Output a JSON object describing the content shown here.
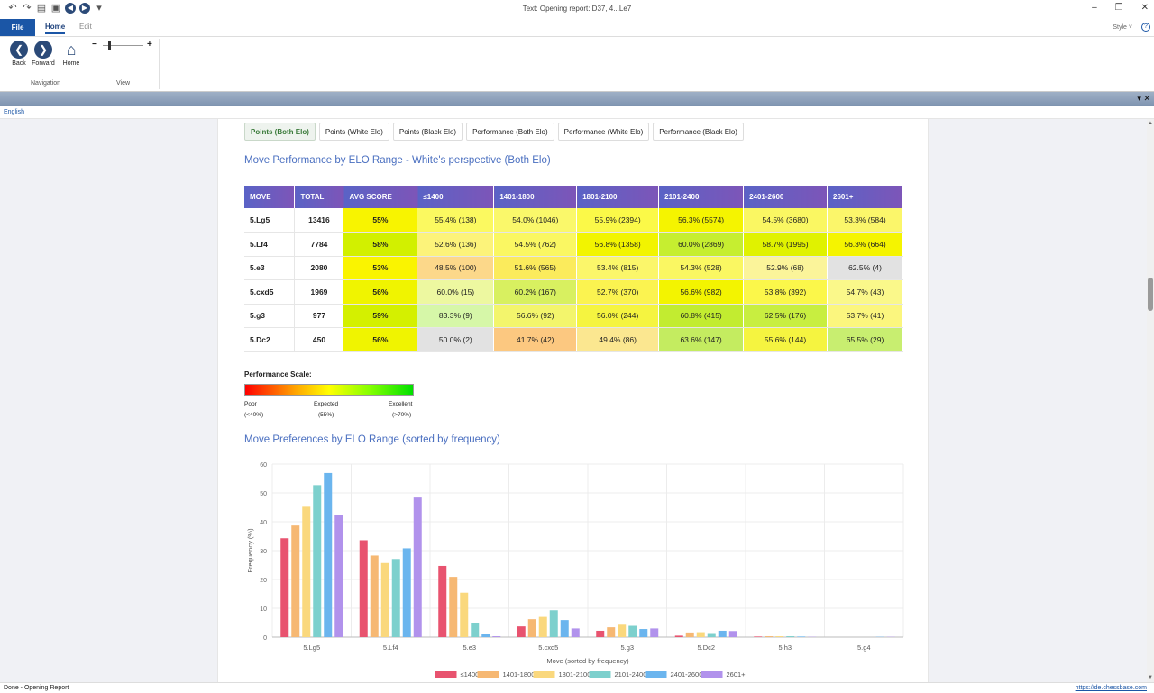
{
  "window": {
    "title": "Text: Opening report: D37,   4...Le7"
  },
  "ribbon": {
    "tabs": {
      "file": "File",
      "home": "Home",
      "edit": "Edit"
    },
    "style_label": "Style",
    "buttons": {
      "back": "Back",
      "forward": "Forward",
      "home": "Home"
    },
    "groups": {
      "navigation": "Navigation",
      "view": "View"
    }
  },
  "doc_tab": "English",
  "subtabs": [
    "Points (Both Elo)",
    "Points (White Elo)",
    "Points (Black Elo)",
    "Performance (Both Elo)",
    "Performance (White Elo)",
    "Performance (Black Elo)"
  ],
  "perf": {
    "title": "Move Performance by ELO Range - White's perspective (Both Elo)",
    "headers": [
      "MOVE",
      "TOTAL",
      "AVG SCORE",
      "≤1400",
      "1401-1800",
      "1801-2100",
      "2101-2400",
      "2401-2600",
      "2601+"
    ],
    "rows": [
      {
        "move": "5.Lg5",
        "total": "13416",
        "avg": "55%",
        "avg_bg": "#f8f400",
        "cells": [
          [
            "55.4% (138)",
            "#fbf960"
          ],
          [
            "54.0% (1046)",
            "#faf86a"
          ],
          [
            "55.9% (2394)",
            "#fbf948"
          ],
          [
            "56.3% (5574)",
            "#f5f400"
          ],
          [
            "54.5% (3680)",
            "#faf762"
          ],
          [
            "53.3% (584)",
            "#fbf66a"
          ]
        ]
      },
      {
        "move": "5.Lf4",
        "total": "7784",
        "avg": "58%",
        "avg_bg": "#d2f000",
        "cells": [
          [
            "52.6% (136)",
            "#fcf37a"
          ],
          [
            "54.5% (762)",
            "#faf762"
          ],
          [
            "56.8% (1358)",
            "#f2f400"
          ],
          [
            "60.0% (2869)",
            "#c6ee30"
          ],
          [
            "58.7% (1995)",
            "#e0f200"
          ],
          [
            "56.3% (664)",
            "#f5f400"
          ]
        ]
      },
      {
        "move": "5.e3",
        "total": "2080",
        "avg": "53%",
        "avg_bg": "#faf400",
        "cells": [
          [
            "48.5% (100)",
            "#fcd88a"
          ],
          [
            "51.6% (565)",
            "#fbeb5c"
          ],
          [
            "53.4% (815)",
            "#fbf66a"
          ],
          [
            "54.3% (528)",
            "#faf762"
          ],
          [
            "52.9% (68)",
            "#fbf49a"
          ],
          [
            "62.5% (4)",
            "#e2e2e2"
          ]
        ]
      },
      {
        "move": "5.cxd5",
        "total": "1969",
        "avg": "56%",
        "avg_bg": "#f0f400",
        "cells": [
          [
            "60.0% (15)",
            "#edf8a0"
          ],
          [
            "60.2% (167)",
            "#d8f060"
          ],
          [
            "52.7% (370)",
            "#fbf350"
          ],
          [
            "56.6% (982)",
            "#f3f400"
          ],
          [
            "53.8% (392)",
            "#fbf74a"
          ],
          [
            "54.7% (43)",
            "#faf88a"
          ]
        ]
      },
      {
        "move": "5.g3",
        "total": "977",
        "avg": "59%",
        "avg_bg": "#d4f000",
        "cells": [
          [
            "83.3% (9)",
            "#d6f7a8"
          ],
          [
            "56.6% (92)",
            "#f3f56c"
          ],
          [
            "56.0% (244)",
            "#f5f440"
          ],
          [
            "60.8% (415)",
            "#c2ec30"
          ],
          [
            "62.5% (176)",
            "#c8ee40"
          ],
          [
            "53.7% (41)",
            "#fbf67e"
          ]
        ]
      },
      {
        "move": "5.Dc2",
        "total": "450",
        "avg": "56%",
        "avg_bg": "#f0f400",
        "cells": [
          [
            "50.0% (2)",
            "#e2e2e2"
          ],
          [
            "41.7% (42)",
            "#fcc880"
          ],
          [
            "49.4% (86)",
            "#fbe790"
          ],
          [
            "63.6% (147)",
            "#c4ec60"
          ],
          [
            "55.6% (144)",
            "#f5f440"
          ],
          [
            "65.5% (29)",
            "#c8ee70"
          ]
        ]
      }
    ]
  },
  "scale": {
    "title": "Performance Scale:",
    "poor": "Poor",
    "poor_sub": "(<40%)",
    "expected": "Expected",
    "expected_sub": "(55%)",
    "excellent": "Excellent",
    "excellent_sub": "(>70%)"
  },
  "prefs": {
    "title": "Move Preferences by ELO Range (sorted by frequency)"
  },
  "chart_data": {
    "type": "bar",
    "title": "",
    "xlabel": "Move (sorted by frequency)",
    "ylabel": "Frequency (%)",
    "ylim": [
      0,
      60
    ],
    "yticks": [
      0,
      10,
      20,
      30,
      40,
      50,
      60
    ],
    "categories": [
      "5.Lg5",
      "5.Lf4",
      "5.e3",
      "5.cxd5",
      "5.g3",
      "5.Dc2",
      "5.h3",
      "5.g4"
    ],
    "series": [
      {
        "name": "≤1400",
        "color": "#e8536f",
        "values": [
          34.3,
          33.6,
          24.7,
          3.7,
          2.2,
          0.5,
          0.2,
          0
        ]
      },
      {
        "name": "1401-1800",
        "color": "#f6b873",
        "values": [
          38.7,
          28.3,
          20.9,
          6.2,
          3.4,
          1.6,
          0.3,
          0
        ]
      },
      {
        "name": "1801-2100",
        "color": "#fad87d",
        "values": [
          45.2,
          25.7,
          15.4,
          7.0,
          4.6,
          1.7,
          0.3,
          0
        ]
      },
      {
        "name": "2101-2400",
        "color": "#7dd0cd",
        "values": [
          52.7,
          27.1,
          5.0,
          9.3,
          3.9,
          1.4,
          0.3,
          0
        ]
      },
      {
        "name": "2401-2600",
        "color": "#6bb5ee",
        "values": [
          56.9,
          30.8,
          1.1,
          5.9,
          2.8,
          2.2,
          0.2,
          0.1
        ]
      },
      {
        "name": "2601+",
        "color": "#b192ec",
        "values": [
          42.4,
          48.4,
          0.3,
          3.0,
          3.0,
          2.1,
          0.1,
          0.1
        ]
      }
    ],
    "grid": true,
    "legend": "bottom"
  },
  "status": {
    "left": "Done - Opening Report",
    "right": "https://de.chessbase.com"
  }
}
